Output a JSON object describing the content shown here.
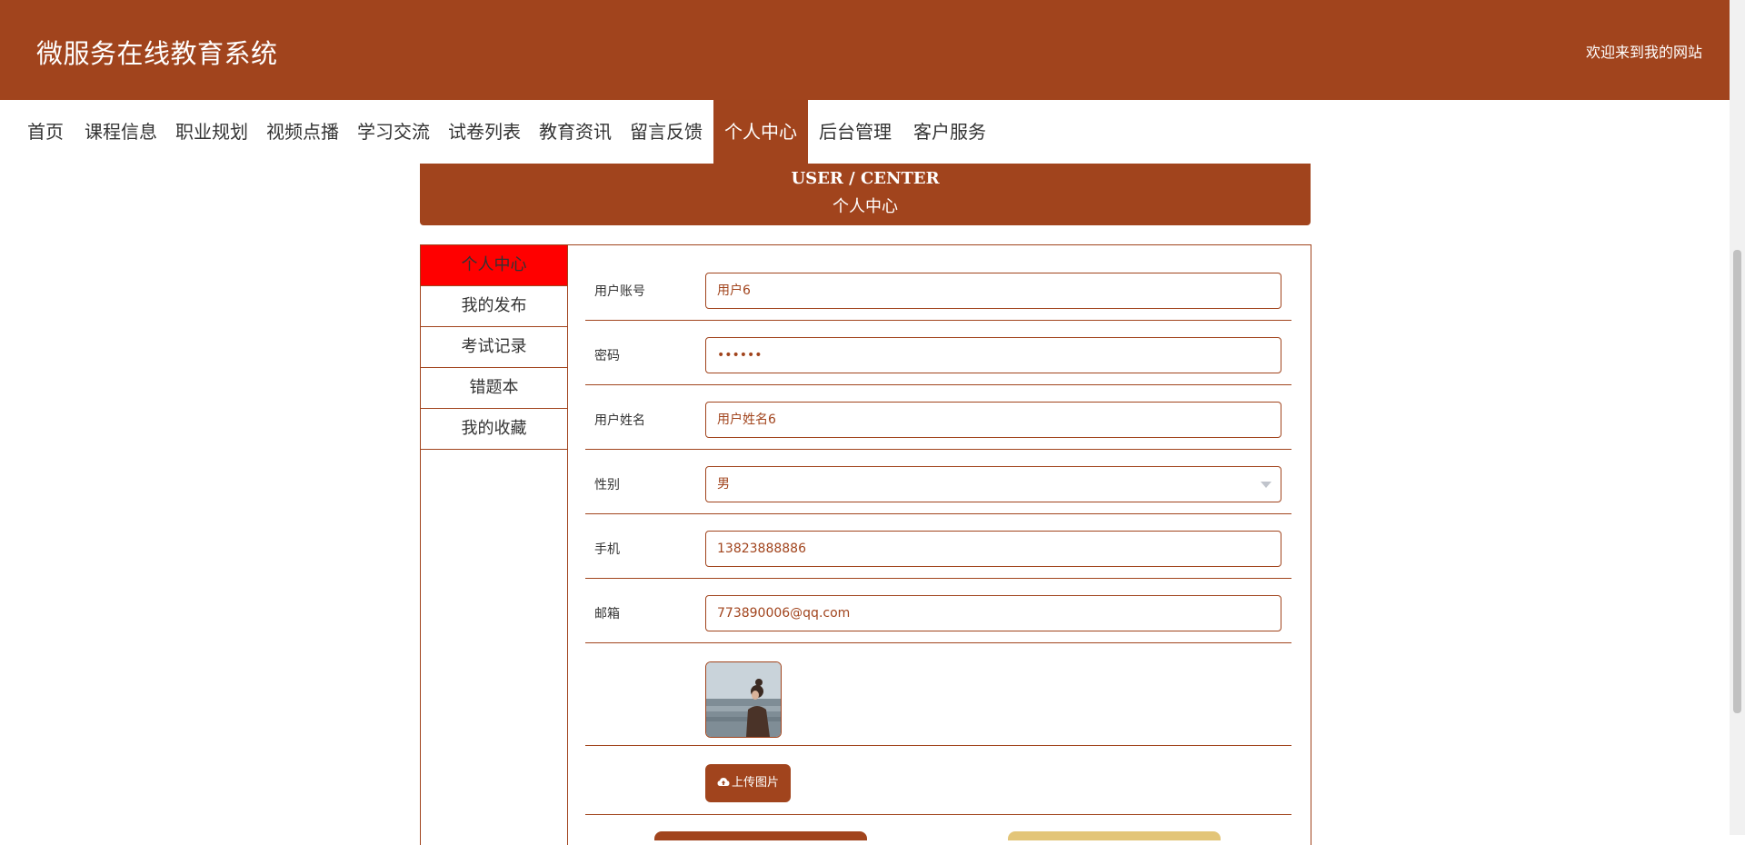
{
  "header": {
    "logo": "微服务在线教育系统",
    "welcome": "欢迎来到我的网站"
  },
  "nav": {
    "items": [
      {
        "label": "首页"
      },
      {
        "label": "课程信息"
      },
      {
        "label": "职业规划"
      },
      {
        "label": "视频点播"
      },
      {
        "label": "学习交流"
      },
      {
        "label": "试卷列表"
      },
      {
        "label": "教育资讯"
      },
      {
        "label": "留言反馈"
      },
      {
        "label": "个人中心"
      },
      {
        "label": "后台管理"
      },
      {
        "label": "客户服务"
      }
    ],
    "active_index": 8
  },
  "banner": {
    "en": "USER / CENTER",
    "cn": "个人中心"
  },
  "sidebar": {
    "items": [
      {
        "label": "个人中心"
      },
      {
        "label": "我的发布"
      },
      {
        "label": "考试记录"
      },
      {
        "label": "错题本"
      },
      {
        "label": "我的收藏"
      }
    ]
  },
  "form": {
    "account": {
      "label": "用户账号",
      "value": "用户6"
    },
    "password": {
      "label": "密码",
      "value": "••••••"
    },
    "name": {
      "label": "用户姓名",
      "value": "用户姓名6"
    },
    "gender": {
      "label": "性别",
      "value": "男"
    },
    "phone": {
      "label": "手机",
      "value": "13823888886"
    },
    "email": {
      "label": "邮箱",
      "value": "773890006@qq.com"
    },
    "upload_label": "上传图片"
  },
  "colors": {
    "brand": "#a1441d",
    "active_sidebar": "#ff0000",
    "secondary_button": "#e3c578"
  },
  "icons": {
    "upload": "cloud-upload-icon",
    "select": "chevron-down-icon"
  }
}
